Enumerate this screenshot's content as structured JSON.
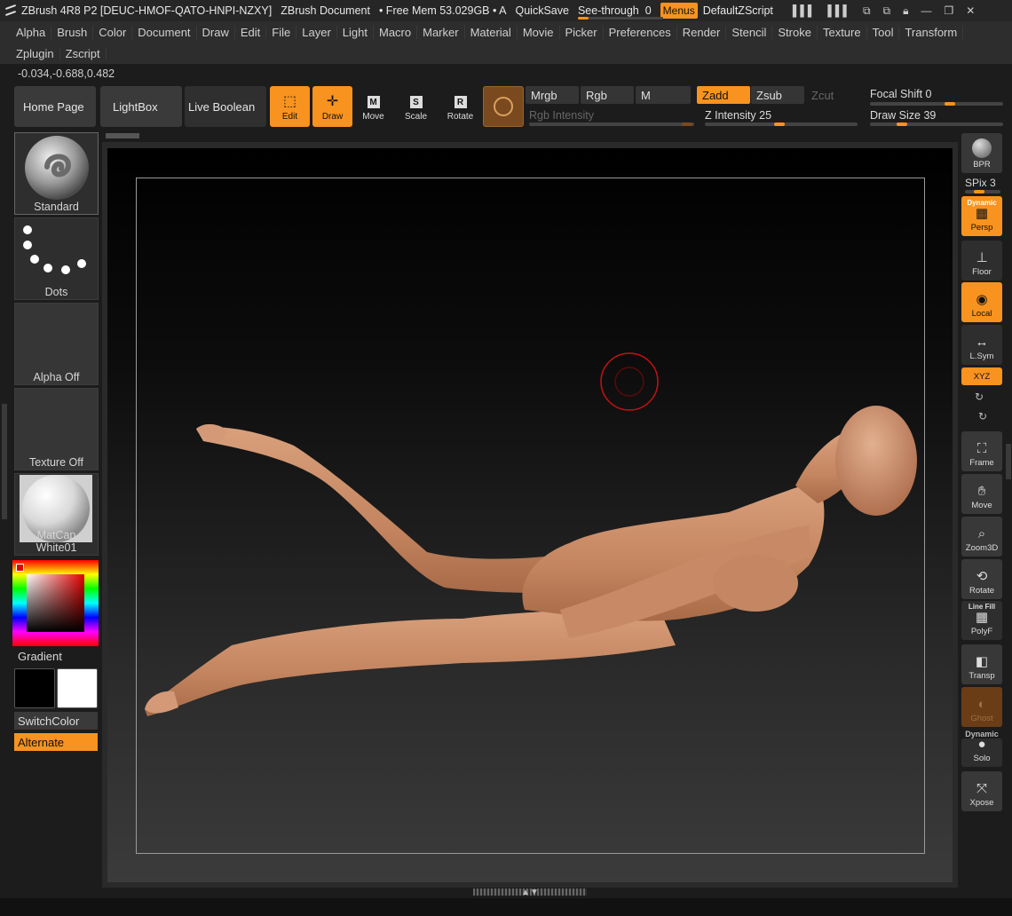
{
  "titlebar": {
    "app": "ZBrush 4R8 P2 [DEUC-HMOF-QATO-HNPI-NZXY]",
    "document": "ZBrush Document",
    "free_mem": "• Free Mem 53.029GB • A",
    "quicksave": "QuickSave",
    "see_through_label": "See-through",
    "see_through_value": "0",
    "menus": "Menus",
    "zscript": "DefaultZScript"
  },
  "menus": {
    "row1": [
      "Alpha",
      "Brush",
      "Color",
      "Document",
      "Draw",
      "Edit",
      "File",
      "Layer",
      "Light",
      "Macro",
      "Marker",
      "Material",
      "Movie",
      "Picker",
      "Preferences",
      "Render",
      "Stencil",
      "Stroke",
      "Texture",
      "Tool",
      "Transform"
    ],
    "row2": [
      "Zplugin",
      "Zscript"
    ]
  },
  "coords": "-0.034,-0.688,0.482",
  "nav": {
    "home": "Home Page",
    "lightbox": "LightBox",
    "live_boolean": "Live Boolean"
  },
  "tools": {
    "edit": "Edit",
    "draw": "Draw",
    "move": "Move",
    "scale": "Scale",
    "rotate": "Rotate",
    "move_key": "M",
    "scale_key": "S",
    "rotate_key": "R"
  },
  "color_modes": {
    "mrgb": "Mrgb",
    "rgb": "Rgb",
    "m": "M",
    "rgb_intensity": "Rgb Intensity"
  },
  "z_modes": {
    "zadd": "Zadd",
    "zsub": "Zsub",
    "zcut": "Zcut",
    "z_intensity_label": "Z Intensity",
    "z_intensity": "25"
  },
  "sliders": {
    "focal_shift_label": "Focal Shift",
    "focal_shift": "0",
    "draw_size_label": "Draw Size",
    "draw_size": "39"
  },
  "left": {
    "brush": "Standard",
    "stroke": "Dots",
    "alpha": "Alpha Off",
    "texture": "Texture Off",
    "material": "MatCap White01",
    "gradient": "Gradient",
    "switch_color": "SwitchColor",
    "alternate": "Alternate",
    "primary_color": "#000000",
    "secondary_color": "#ffffff"
  },
  "right": {
    "bpr": "BPR",
    "spix_label": "SPix",
    "spix": "3",
    "dynamic": "Dynamic",
    "persp": "Persp",
    "floor": "Floor",
    "local": "Local",
    "lsym": "L.Sym",
    "xyz": "XYZ",
    "frame": "Frame",
    "move": "Move",
    "zoom3d": "Zoom3D",
    "rotate": "Rotate",
    "line_fill": "Line Fill",
    "polyf": "PolyF",
    "transp": "Transp",
    "ghost": "Ghost",
    "dynamic2": "Dynamic",
    "solo": "Solo",
    "xpose": "Xpose"
  },
  "colors": {
    "accent": "#f7931e",
    "panel": "#2d2d2d",
    "skin": "#c98a64"
  }
}
